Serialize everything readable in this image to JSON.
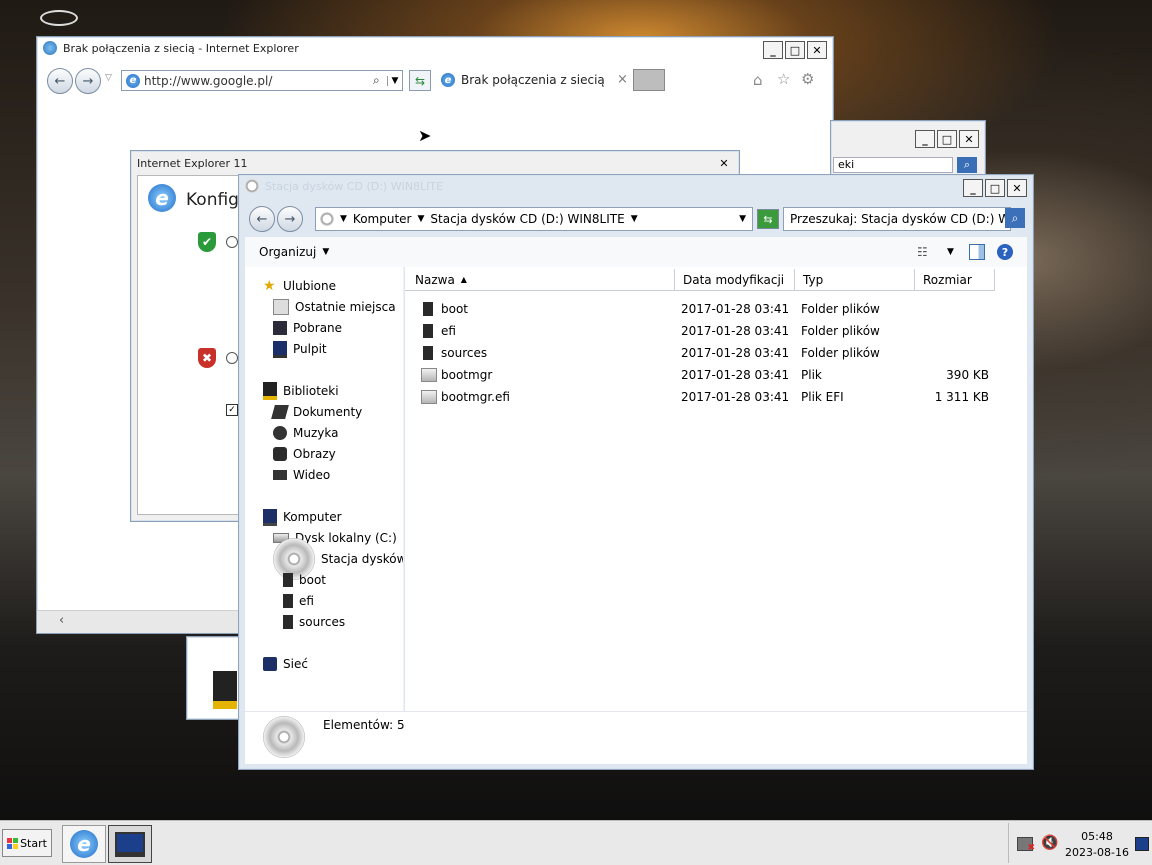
{
  "ie": {
    "title": "Brak połączenia z siecią - Internet Explorer",
    "url": "http://www.google.pl/",
    "tab_title": "Brak połączenia z siecią",
    "tab_close": "×"
  },
  "ie_dialog": {
    "title": "Internet Explorer 11",
    "heading": "Konfigu"
  },
  "background_window": {
    "search_fragment": "eki"
  },
  "window_controls": {
    "minimize": "_",
    "maximize": "□",
    "close": "✕"
  },
  "explorer": {
    "title": "Stacja dysków CD (D:) WIN8LITE",
    "breadcrumb": [
      "Komputer",
      "Stacja dysków CD (D:) WIN8LITE"
    ],
    "search_placeholder": "Przeszukaj: Stacja dysków CD (D:) W...",
    "toolbar": {
      "organize": "Organizuj"
    },
    "nav": {
      "favorites": "Ulubione",
      "favorites_items": [
        "Ostatnie miejsca",
        "Pobrane",
        "Pulpit"
      ],
      "libraries": "Biblioteki",
      "library_items": [
        "Dokumenty",
        "Muzyka",
        "Obrazy",
        "Wideo"
      ],
      "computer": "Komputer",
      "computer_items": [
        "Dysk lokalny (C:)",
        "Stacja dysków CD (D"
      ],
      "cd_items": [
        "boot",
        "efi",
        "sources"
      ],
      "network": "Sieć"
    },
    "columns": [
      "Nazwa",
      "Data modyfikacji",
      "Typ",
      "Rozmiar"
    ],
    "files": [
      {
        "name": "boot",
        "date": "2017-01-28 03:41",
        "type": "Folder plików",
        "size": ""
      },
      {
        "name": "efi",
        "date": "2017-01-28 03:41",
        "type": "Folder plików",
        "size": ""
      },
      {
        "name": "sources",
        "date": "2017-01-28 03:41",
        "type": "Folder plików",
        "size": ""
      },
      {
        "name": "bootmgr",
        "date": "2017-01-28 03:41",
        "type": "Plik",
        "size": "390 KB"
      },
      {
        "name": "bootmgr.efi",
        "date": "2017-01-28 03:41",
        "type": "Plik EFI",
        "size": "1 311 KB"
      }
    ],
    "status": "Elementów: 5"
  },
  "taskbar": {
    "start": "Start",
    "time": "05:48",
    "date": "2023-08-16"
  },
  "colors": {
    "titlebar_text_explorer": "#c9d3df",
    "folder_icon": "#2a2a2a",
    "shield_green": "#2a9a3a",
    "shield_red": "#c8302a"
  }
}
